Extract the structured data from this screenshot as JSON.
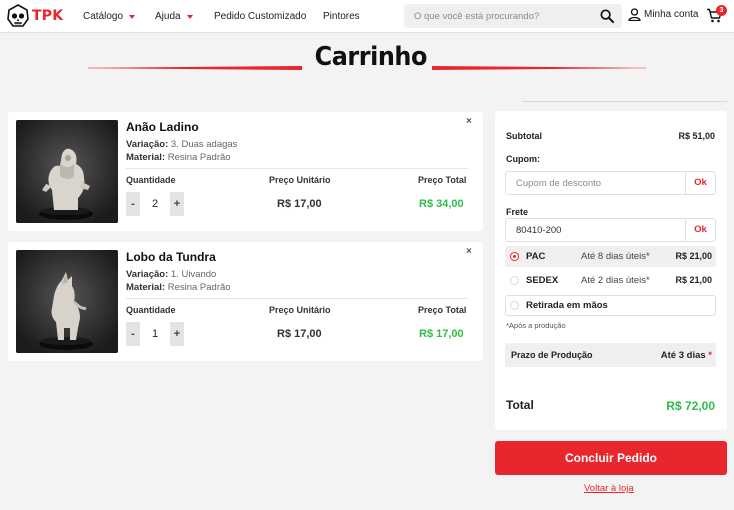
{
  "brand": {
    "logo_text": "TPK",
    "accent": "#e8262d",
    "success": "#2ebd4a"
  },
  "nav": {
    "items": [
      {
        "label": "Catálogo",
        "dropdown": true
      },
      {
        "label": "Ajuda",
        "dropdown": true
      },
      {
        "label": "Pedido Customizado",
        "dropdown": false
      },
      {
        "label": "Pintores",
        "dropdown": false
      }
    ],
    "search_placeholder": "O que você está procurando?",
    "account_label": "Minha conta",
    "cart_count": "3"
  },
  "page_title": "Carrinho",
  "cart": {
    "quantity_label": "Quantidade",
    "unit_price_label": "Preço Unitário",
    "total_price_label": "Preço Total",
    "variation_prefix": "Variação:",
    "material_prefix": "Material:",
    "remove_icon": "×",
    "items": [
      {
        "name": "Anão Ladino",
        "variation": "3. Duas adagas",
        "material": "Resina Padrão",
        "quantity": "2",
        "unit_price": "R$ 17,00",
        "total_price": "R$ 34,00"
      },
      {
        "name": "Lobo da Tundra",
        "variation": "1. Uivando",
        "material": "Resina Padrão",
        "quantity": "1",
        "unit_price": "R$ 17,00",
        "total_price": "R$ 17,00"
      }
    ]
  },
  "summary": {
    "subtotal_label": "Subtotal",
    "subtotal_value": "R$ 51,00",
    "coupon_label": "Cupom:",
    "coupon_placeholder": "Cupom de desconto",
    "ok_label": "Ok",
    "freight_label": "Frete",
    "freight_cep": "80410-200",
    "shipping_options": [
      {
        "name": "PAC",
        "time": "Até 8 dias úteis*",
        "price": "R$ 21,00",
        "selected": true
      },
      {
        "name": "SEDEX",
        "time": "Até 2 dias úteis*",
        "price": "R$ 21,00",
        "selected": false
      },
      {
        "name": "Retirada em mãos",
        "time": "",
        "price": "",
        "selected": false
      }
    ],
    "shipping_note": "*Após a produção",
    "production_label": "Prazo de Produção",
    "production_value": "Até 3 dias",
    "production_mark": "*",
    "total_label": "Total",
    "total_value": "R$ 72,00"
  },
  "checkout_label": "Concluir Pedido",
  "back_label": "Voltar à loja"
}
